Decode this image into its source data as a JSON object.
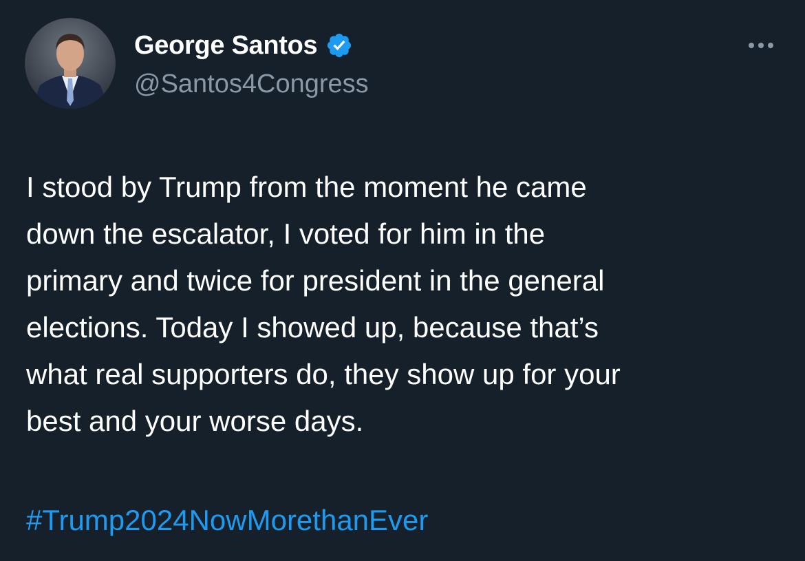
{
  "theme": {
    "background": "#15202b",
    "text_primary": "#ffffff",
    "text_secondary": "#8b98a5",
    "link": "#1d9bf0",
    "verified": "#1d9bf0"
  },
  "author": {
    "display_name": "George Santos",
    "handle": "@Santos4Congress",
    "verified": true,
    "avatar_icon": "profile-photo"
  },
  "menu": {
    "icon": "more-horizontal-icon"
  },
  "tweet": {
    "lines": [
      "I stood by Trump from the moment he came",
      "down the escalator, I voted for him in the",
      "primary and twice for president in the general",
      "elections. Today I showed up, because that’s",
      "what real supporters do, they show up for your",
      "best and your worse days."
    ],
    "hashtag": "#Trump2024NowMorethanEver"
  }
}
